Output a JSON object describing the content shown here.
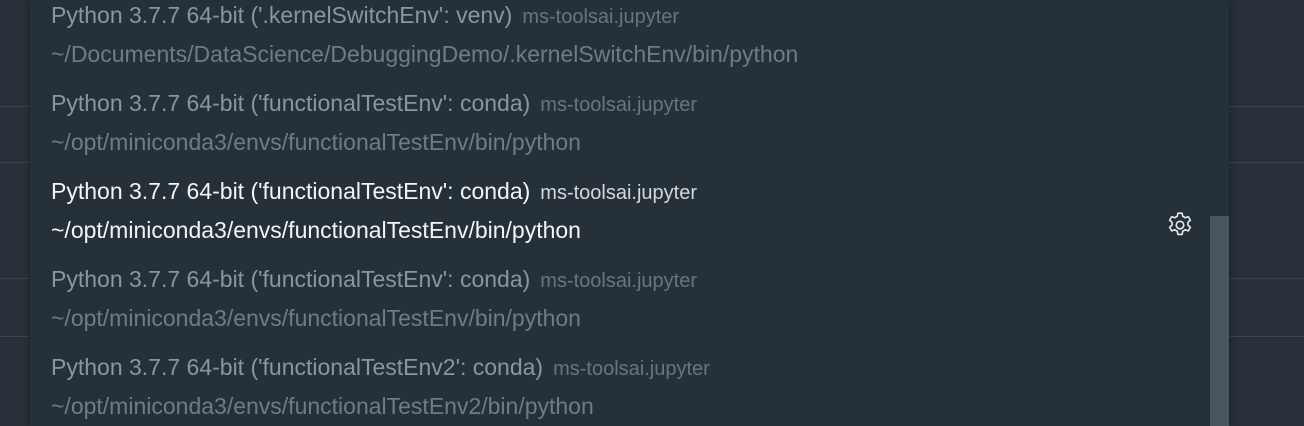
{
  "kernel_picker": {
    "items": [
      {
        "label": "Python 3.7.7 64-bit ('.kernelSwitchEnv': venv)",
        "description": "ms-toolsai.jupyter",
        "detail": "~/Documents/DataScience/DebuggingDemo/.kernelSwitchEnv/bin/python"
      },
      {
        "label": "Python 3.7.7 64-bit ('functionalTestEnv': conda)",
        "description": "ms-toolsai.jupyter",
        "detail": "~/opt/miniconda3/envs/functionalTestEnv/bin/python"
      },
      {
        "label": "Python 3.7.7 64-bit ('functionalTestEnv': conda)",
        "description": "ms-toolsai.jupyter",
        "detail": "~/opt/miniconda3/envs/functionalTestEnv/bin/python",
        "focused": true,
        "action_icon": "gear-icon"
      },
      {
        "label": "Python 3.7.7 64-bit ('functionalTestEnv': conda)",
        "description": "ms-toolsai.jupyter",
        "detail": "~/opt/miniconda3/envs/functionalTestEnv/bin/python"
      },
      {
        "label": "Python 3.7.7 64-bit ('functionalTestEnv2': conda)",
        "description": "ms-toolsai.jupyter",
        "detail": "~/opt/miniconda3/envs/functionalTestEnv2/bin/python"
      }
    ]
  },
  "colors": {
    "background": "#283139",
    "list_background": "#263038",
    "focused_text": "#f3f5f6",
    "dim_text": "#8a969f",
    "scrollbar": "#4a555e"
  }
}
